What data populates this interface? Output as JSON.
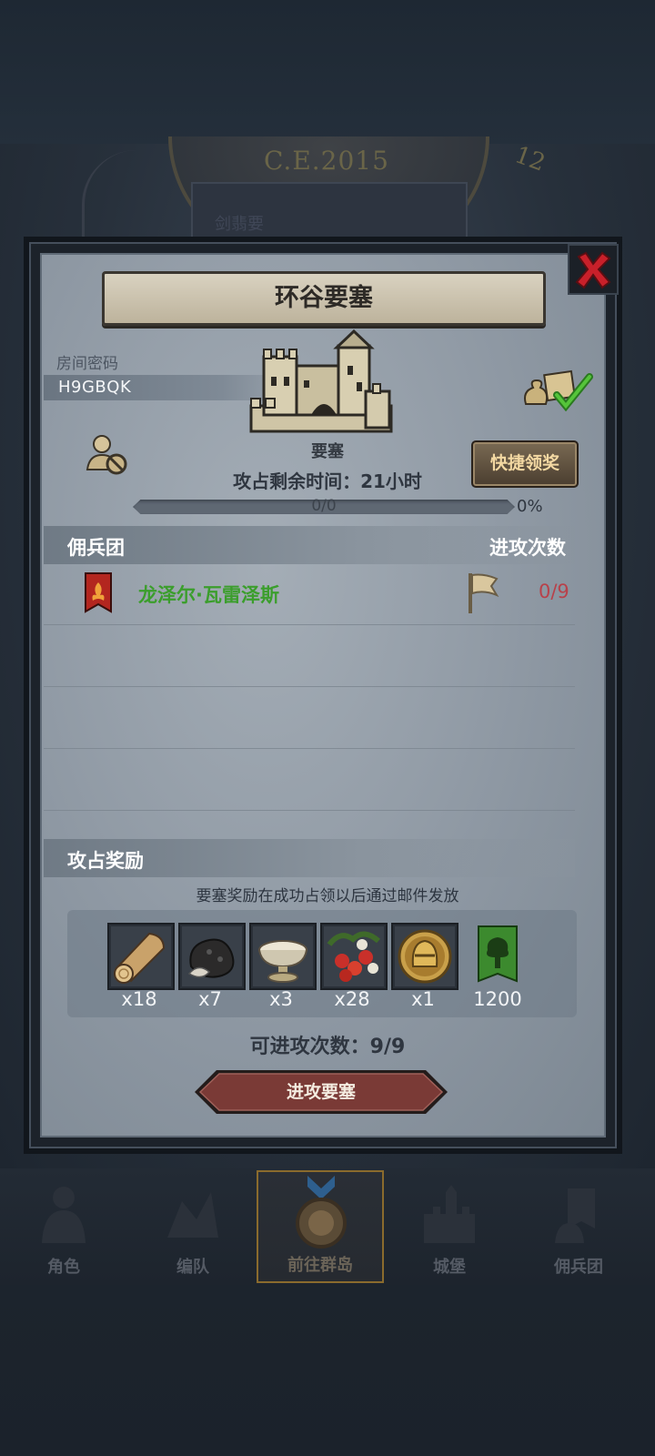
{
  "background": {
    "year": "C.E.2015",
    "clock_number": "12",
    "plaque_text": "剑翡要"
  },
  "dialog": {
    "title": "环谷要塞",
    "room_code_label": "房间密码",
    "room_code": "H9GBQK",
    "fortress_label": "要塞",
    "capture_time": "攻占剩余时间：21小时",
    "quick_claim_label": "快捷领奖",
    "progress": {
      "text": "0/0",
      "percent_label": "0%",
      "value": 0
    },
    "mercenary_header": "佣兵团",
    "attack_count_header": "进攻次数",
    "mercenaries": [
      {
        "name": "龙泽尔·瓦雷泽斯",
        "attacks": "0/9"
      }
    ],
    "rewards_header": "攻占奖励",
    "rewards_note": "要塞奖励在成功占领以后通过邮件发放",
    "rewards": [
      {
        "icon": "wood-log-icon",
        "qty": "x18"
      },
      {
        "icon": "truffle-icon",
        "qty": "x7"
      },
      {
        "icon": "silver-bowl-icon",
        "qty": "x3"
      },
      {
        "icon": "berries-icon",
        "qty": "x28"
      },
      {
        "icon": "knight-helmet-coin-icon",
        "qty": "x1"
      },
      {
        "icon": "guild-tree-banner-icon",
        "qty": "1200"
      }
    ],
    "attacks_remaining": "可进攻次数：9/9",
    "attack_button": "进攻要塞"
  },
  "nav": {
    "items": [
      {
        "label": "角色"
      },
      {
        "label": "编队"
      },
      {
        "label": "前往群岛"
      },
      {
        "label": "城堡"
      },
      {
        "label": "佣兵团"
      }
    ]
  },
  "colors": {
    "merc_name": "#3b9e2c",
    "attack_count": "#b8414a",
    "quick_claim_text": "#f3d8a2",
    "attack_button": "#7a3a36"
  }
}
